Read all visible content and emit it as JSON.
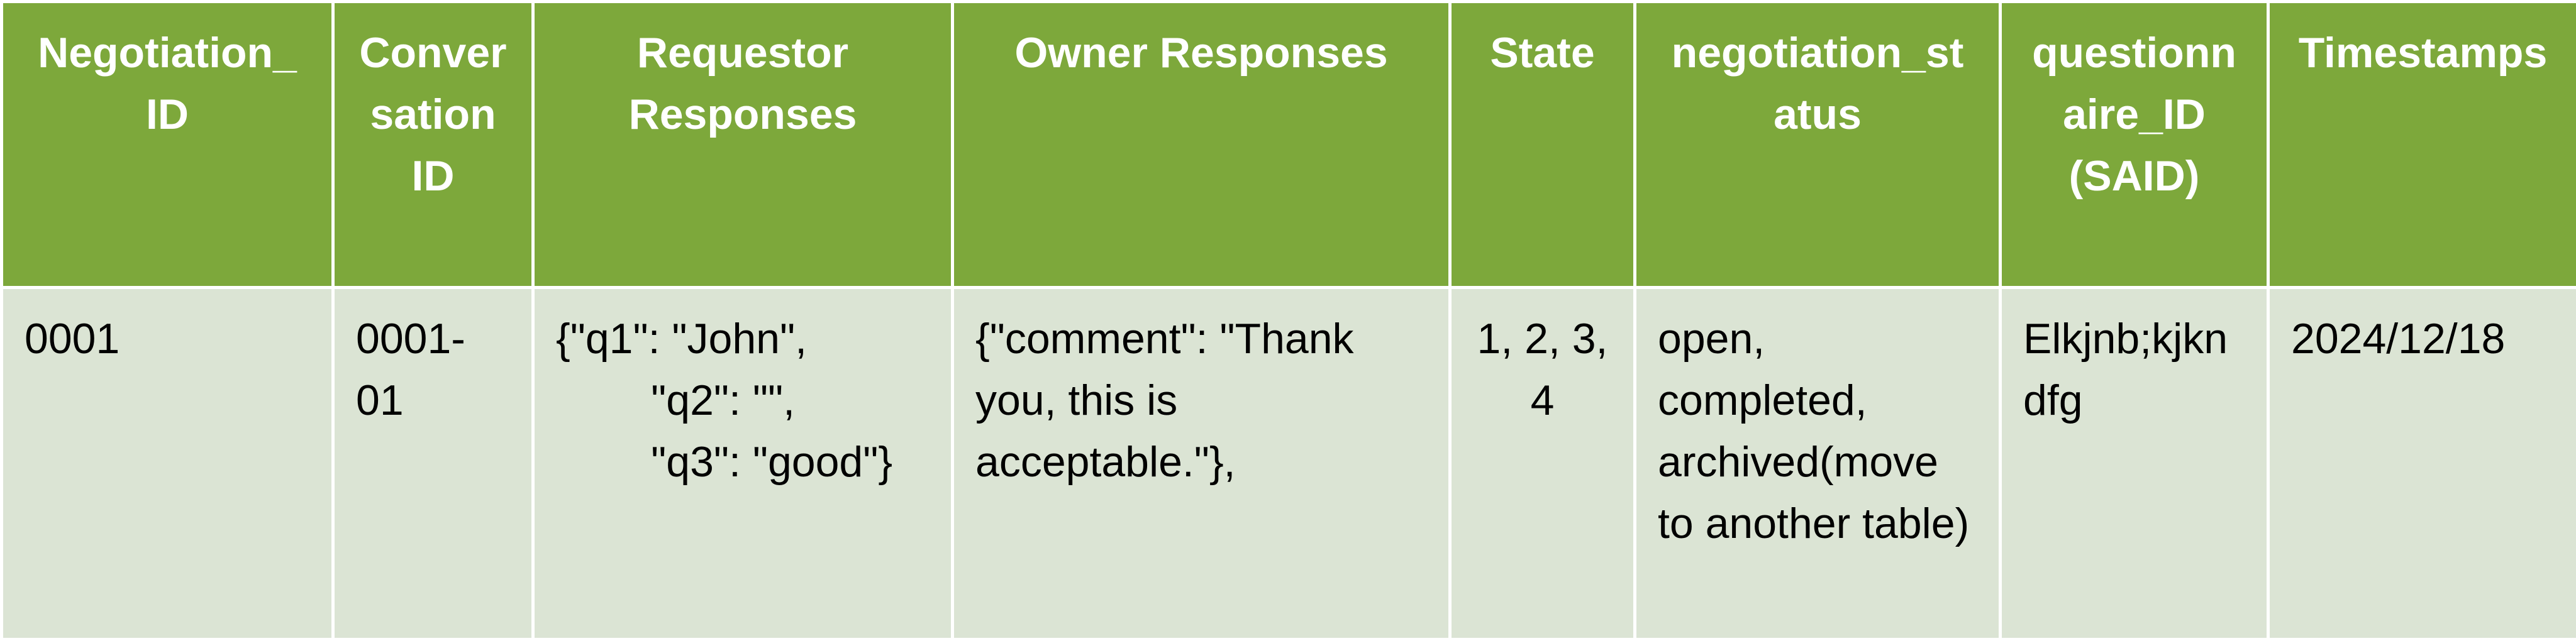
{
  "table": {
    "headers": [
      "Negotiation_ ID",
      "Conver sation ID",
      "Requestor Responses",
      "Owner Responses",
      "State",
      "negotiation_st atus",
      "questionn aire_ID (SAID)",
      "Timestamps"
    ],
    "rows": [
      {
        "negotiation_id": "0001",
        "conversation_id": "0001- 01",
        "requestor_responses": "{\"q1\": \"John\",\n        \"q2\": \"\",\n        \"q3\": \"good\"}",
        "owner_responses": "{\"comment\": \"Thank you, this is acceptable.\"},",
        "state": "1, 2, 3, 4",
        "negotiation_status": "open, completed, archived(move to another table)",
        "questionnaire_id": "Elkjnb;kjkndfg",
        "timestamps": "2024/12/18"
      }
    ]
  },
  "colors": {
    "header_bg": "#7da83b",
    "header_text": "#ffffff",
    "cell_bg": "#dbe4d4",
    "border": "#ffffff"
  }
}
